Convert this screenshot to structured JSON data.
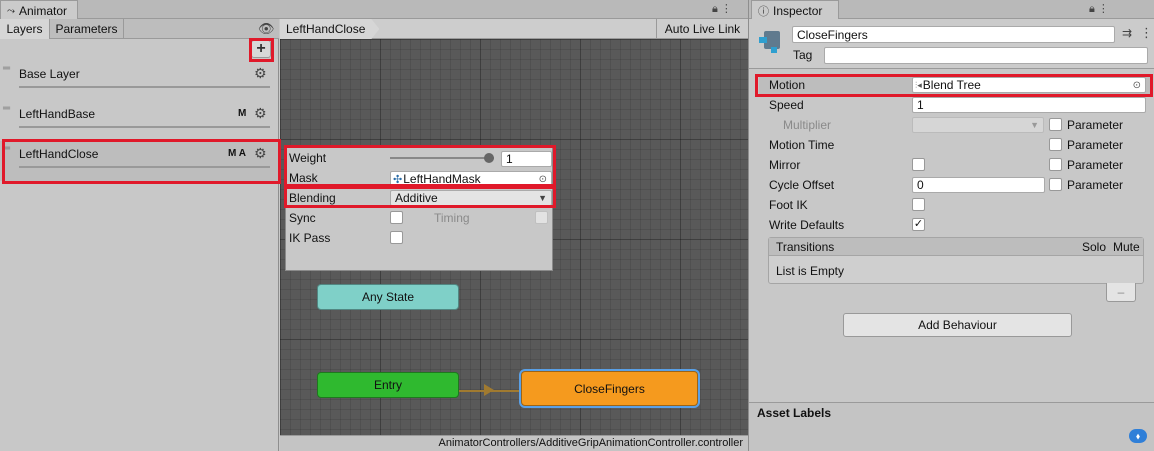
{
  "animator": {
    "tab_title": "Animator",
    "tabs": [
      "Layers",
      "Parameters"
    ],
    "layers": [
      {
        "name": "Base Layer",
        "badges": ""
      },
      {
        "name": "LeftHandBase",
        "badges": "M"
      },
      {
        "name": "LeftHandClose",
        "badges": "M A"
      }
    ],
    "breadcrumb": "LeftHandClose",
    "auto_live_link": "Auto Live Link",
    "footer_path": "AnimatorControllers/AdditiveGripAnimationController.controller",
    "layer_settings": {
      "weight_label": "Weight",
      "weight_value": "1",
      "weight_fraction": 1.0,
      "mask_label": "Mask",
      "mask_value": "LeftHandMask",
      "blending_label": "Blending",
      "blending_value": "Additive",
      "sync_label": "Sync",
      "timing_label": "Timing",
      "ik_pass_label": "IK Pass"
    },
    "states": {
      "any_state": "Any State",
      "entry": "Entry",
      "close_fingers": "CloseFingers"
    },
    "colors": {
      "any_state": "#7fd0c8",
      "entry": "#2fb92f",
      "close_fingers": "#f59a1e",
      "highlight": "#e0192a"
    }
  },
  "inspector": {
    "tab_title": "Inspector",
    "object_name": "CloseFingers",
    "tag_label": "Tag",
    "rows": {
      "motion_label": "Motion",
      "motion_value": "Blend Tree",
      "speed_label": "Speed",
      "speed_value": "1",
      "multiplier_label": "Multiplier",
      "motion_time_label": "Motion Time",
      "mirror_label": "Mirror",
      "cycle_offset_label": "Cycle Offset",
      "cycle_offset_value": "0",
      "foot_ik_label": "Foot IK",
      "write_defaults_label": "Write Defaults",
      "parameter_label": "Parameter"
    },
    "write_defaults_checked": true,
    "transitions": {
      "header": "Transitions",
      "solo": "Solo",
      "mute": "Mute",
      "empty": "List is Empty",
      "remove": "–"
    },
    "add_behaviour": "Add Behaviour",
    "asset_labels": "Asset Labels"
  }
}
